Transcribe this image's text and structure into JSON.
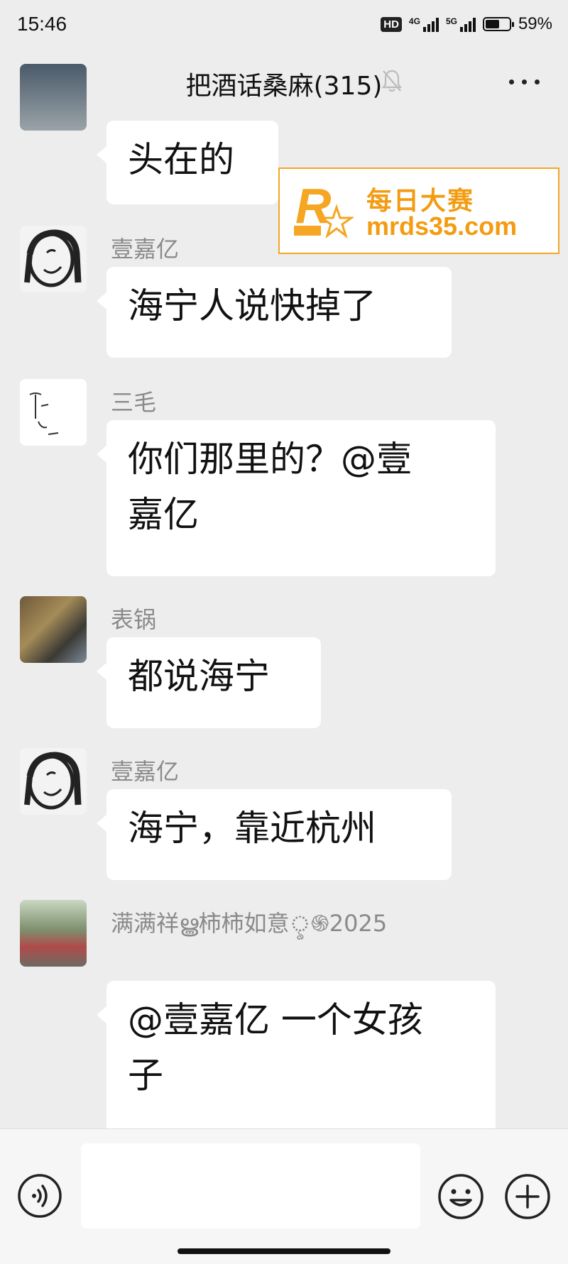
{
  "status_bar": {
    "time": "15:46",
    "hd_badge": "HD",
    "network_1": "4G",
    "network_2": "5G",
    "battery_text": "59%",
    "battery_level": 0.59
  },
  "header": {
    "title": "把酒话桑麻(315)",
    "back_icon": "chevron-left-icon",
    "mute_icon": "bell-off-icon",
    "more_icon": "more-dots-icon"
  },
  "watermark": {
    "chinese": "每日大赛",
    "url": "mrds35.com",
    "logo_small_text": "每日大赛"
  },
  "messages": [
    {
      "sender": "",
      "text": "头在的"
    },
    {
      "sender": "壹嘉亿",
      "text": "海宁人说快掉了"
    },
    {
      "sender": "三毛",
      "line1": "你们那里的？@壹",
      "line2": "嘉亿"
    },
    {
      "sender": "表锅",
      "text": "都说海宁"
    },
    {
      "sender": "壹嘉亿",
      "text": "海宁，靠近杭州"
    },
    {
      "sender": "满满祥ൠ柿柿如意ৢ֍2025",
      "line1": "@壹嘉亿  一个女孩",
      "line2": "子"
    }
  ],
  "input_bar": {
    "placeholder": "",
    "voice_icon": "voice-icon",
    "emoji_icon": "emoji-icon",
    "plus_icon": "plus-icon"
  },
  "colors": {
    "background": "#ededed",
    "bubble": "#ffffff",
    "sender_name": "#8a8a8a",
    "watermark": "#f39c12"
  }
}
